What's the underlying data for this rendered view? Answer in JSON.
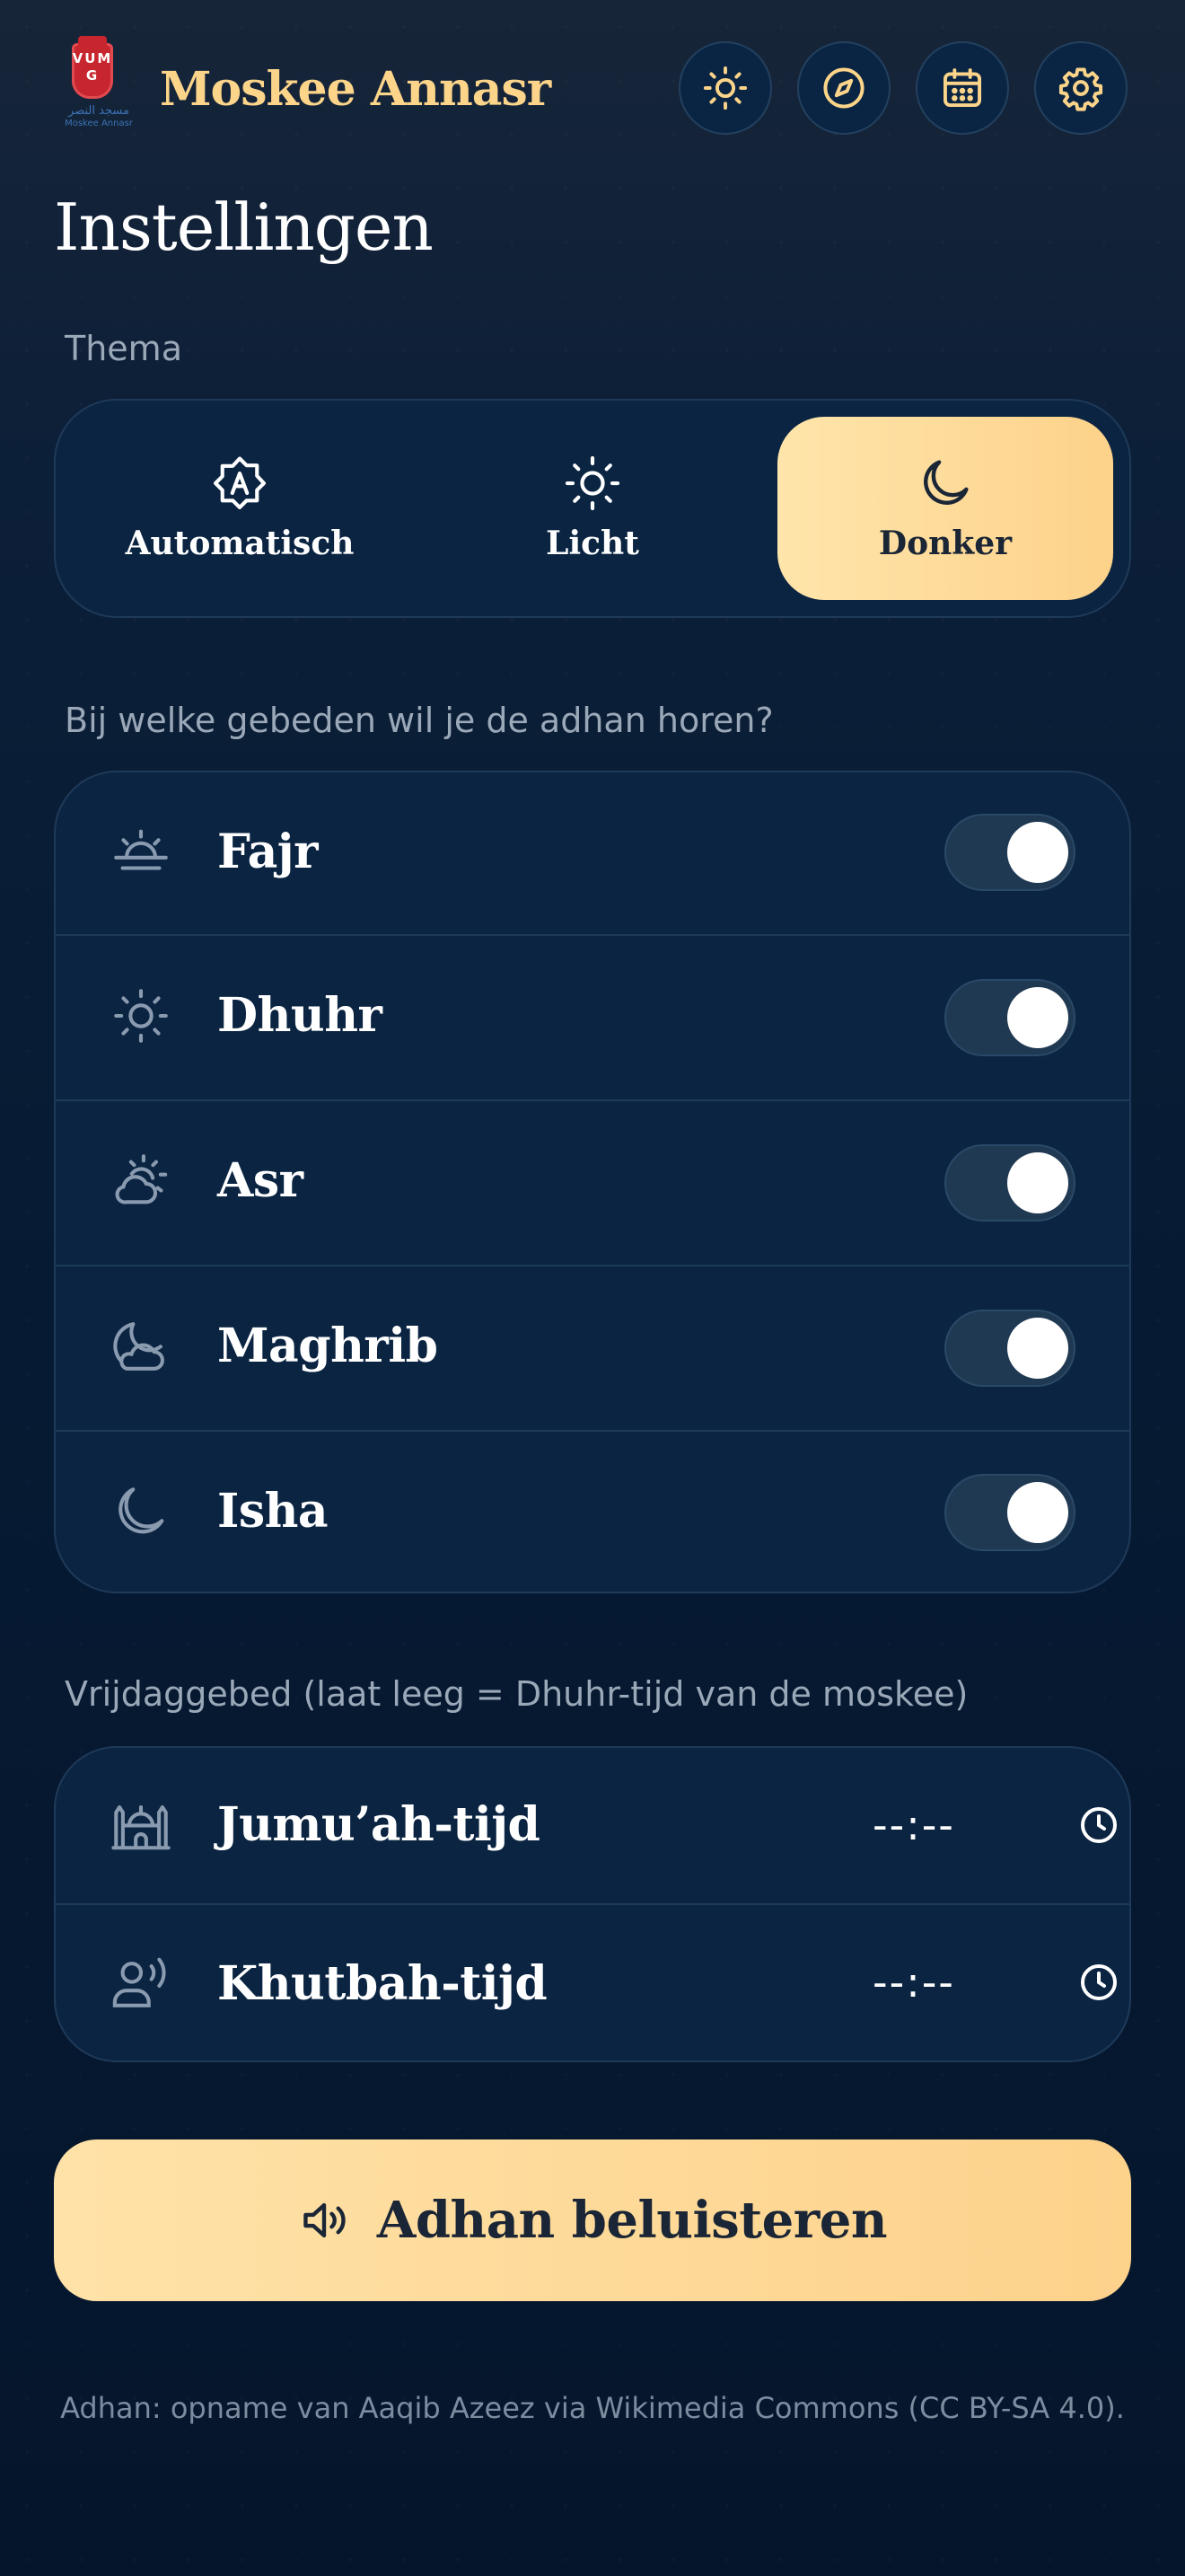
{
  "header": {
    "logo_letters": "VUMG",
    "logo_arabic": "مسجد النصر",
    "logo_sub": "Moskee Annasr",
    "app_title": "Moskee Annasr",
    "nav_icons": [
      "sun-icon",
      "compass-icon",
      "calendar-icon",
      "gear-icon"
    ]
  },
  "page": {
    "title": "Instellingen"
  },
  "theme": {
    "label": "Thema",
    "options": [
      {
        "label": "Automatisch",
        "icon": "auto-theme-icon",
        "active": false
      },
      {
        "label": "Licht",
        "icon": "sun-icon",
        "active": false
      },
      {
        "label": "Donker",
        "icon": "moon-icon",
        "active": true
      }
    ]
  },
  "adhan_prayers": {
    "label": "Bij welke gebeden wil je de adhan horen?",
    "items": [
      {
        "name": "Fajr",
        "icon": "sunrise-icon",
        "enabled": true
      },
      {
        "name": "Dhuhr",
        "icon": "sun-icon",
        "enabled": true
      },
      {
        "name": "Asr",
        "icon": "sun-cloud-icon",
        "enabled": true
      },
      {
        "name": "Maghrib",
        "icon": "moon-cloud-icon",
        "enabled": true
      },
      {
        "name": "Isha",
        "icon": "moon-icon",
        "enabled": true
      }
    ]
  },
  "friday": {
    "label": "Vrijdaggebed (laat leeg = Dhuhr-tijd van de moskee)",
    "items": [
      {
        "name": "Jumu’ah-tijd",
        "icon": "mosque-icon",
        "value": "--:--"
      },
      {
        "name": "Khutbah-tijd",
        "icon": "speaker-person-icon",
        "value": "--:--"
      }
    ]
  },
  "adhan_button": {
    "label": "Adhan beluisteren",
    "icon": "speaker-icon"
  },
  "footer": {
    "note": "Adhan: opname van Aaqib Azeez via Wikimedia Commons (CC BY-SA 4.0)."
  },
  "colors": {
    "accent": "#fdd58a",
    "background": "#061a33",
    "card": "#0a2442",
    "muted_text": "#9aa8b8"
  }
}
